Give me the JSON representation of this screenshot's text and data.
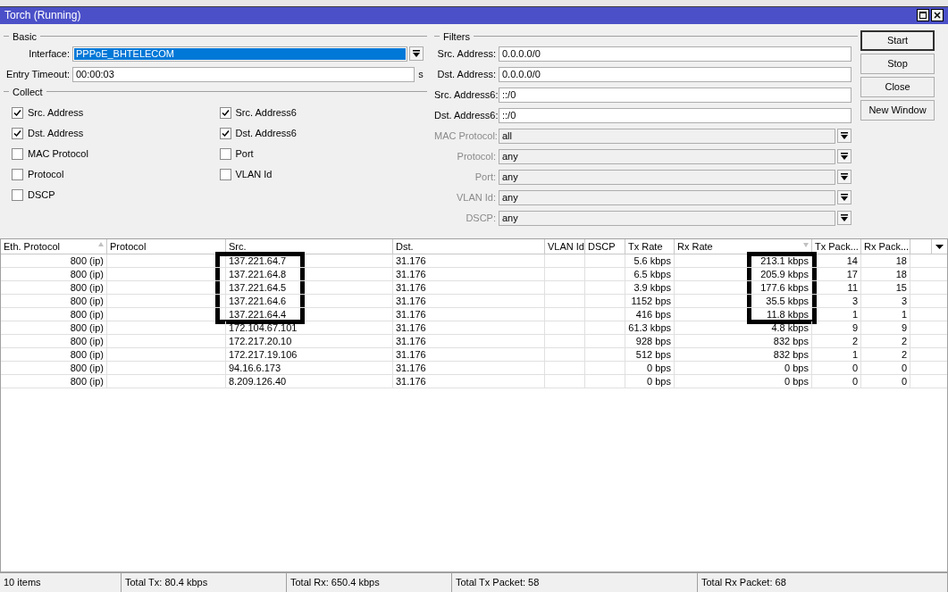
{
  "window": {
    "title": "Torch (Running)"
  },
  "basic": {
    "legend": "Basic",
    "interface": {
      "label": "Interface:",
      "value": "PPPoE_BHTELECOM",
      "selected": true
    },
    "entry_timeout": {
      "label": "Entry Timeout:",
      "value": "00:00:03",
      "unit": "s"
    }
  },
  "collect": {
    "legend": "Collect",
    "columns": [
      [
        {
          "label": "Src. Address",
          "checked": true
        },
        {
          "label": "Dst. Address",
          "checked": true
        },
        {
          "label": "MAC Protocol",
          "checked": false
        },
        {
          "label": "Protocol",
          "checked": false
        },
        {
          "label": "DSCP",
          "checked": false
        }
      ],
      [
        {
          "label": "Src. Address6",
          "checked": true
        },
        {
          "label": "Dst. Address6",
          "checked": true
        },
        {
          "label": "Port",
          "checked": false
        },
        {
          "label": "VLAN Id",
          "checked": false
        }
      ]
    ]
  },
  "filters": {
    "legend": "Filters",
    "fields": [
      {
        "label": "Src. Address:",
        "value": "0.0.0.0/0",
        "kind": "text",
        "disabled": false
      },
      {
        "label": "Dst. Address:",
        "value": "0.0.0.0/0",
        "kind": "text",
        "disabled": false
      },
      {
        "label": "Src. Address6:",
        "value": "::/0",
        "kind": "text",
        "disabled": false
      },
      {
        "label": "Dst. Address6:",
        "value": "::/0",
        "kind": "text",
        "disabled": false
      },
      {
        "label": "MAC Protocol:",
        "value": "all",
        "kind": "select",
        "disabled": true
      },
      {
        "label": "Protocol:",
        "value": "any",
        "kind": "select",
        "disabled": true
      },
      {
        "label": "Port:",
        "value": "any",
        "kind": "select",
        "disabled": true
      },
      {
        "label": "VLAN Id:",
        "value": "any",
        "kind": "select",
        "disabled": true
      },
      {
        "label": "DSCP:",
        "value": "any",
        "kind": "select",
        "disabled": true
      }
    ]
  },
  "buttons": [
    {
      "label": "Start",
      "default": true
    },
    {
      "label": "Stop",
      "default": false
    },
    {
      "label": "Close",
      "default": false
    },
    {
      "label": "New Window",
      "default": false
    }
  ],
  "table": {
    "columns": [
      {
        "label": "Eth. Protocol",
        "sorted": true,
        "descending": false
      },
      {
        "label": "Protocol",
        "sorted": false
      },
      {
        "label": "Src.",
        "sorted": false
      },
      {
        "label": "Dst.",
        "sorted": false
      },
      {
        "label": "VLAN Id",
        "sorted": false
      },
      {
        "label": "DSCP",
        "sorted": false
      },
      {
        "label": "Tx Rate",
        "sorted": false
      },
      {
        "label": "Rx Rate",
        "sorted": true,
        "descending": true
      },
      {
        "label": "Tx Pack...",
        "sorted": false
      },
      {
        "label": "Rx Pack...",
        "sorted": false
      }
    ],
    "rows": [
      {
        "highlighted": true,
        "cells": [
          "800 (ip)",
          "",
          "137.221.64.7",
          "31.176",
          "",
          "",
          "5.6 kbps",
          "213.1 kbps",
          "14",
          "18"
        ]
      },
      {
        "highlighted": true,
        "cells": [
          "800 (ip)",
          "",
          "137.221.64.8",
          "31.176",
          "",
          "",
          "6.5 kbps",
          "205.9 kbps",
          "17",
          "18"
        ]
      },
      {
        "highlighted": true,
        "cells": [
          "800 (ip)",
          "",
          "137.221.64.5",
          "31.176",
          "",
          "",
          "3.9 kbps",
          "177.6 kbps",
          "11",
          "15"
        ]
      },
      {
        "highlighted": true,
        "cells": [
          "800 (ip)",
          "",
          "137.221.64.6",
          "31.176",
          "",
          "",
          "1152 bps",
          "35.5 kbps",
          "3",
          "3"
        ]
      },
      {
        "highlighted": true,
        "cells": [
          "800 (ip)",
          "",
          "137.221.64.4",
          "31.176",
          "",
          "",
          "416 bps",
          "11.8 kbps",
          "1",
          "1"
        ]
      },
      {
        "highlighted": false,
        "cells": [
          "800 (ip)",
          "",
          "172.104.67.101",
          "31.176",
          "",
          "",
          "61.3 kbps",
          "4.8 kbps",
          "9",
          "9"
        ]
      },
      {
        "highlighted": false,
        "cells": [
          "800 (ip)",
          "",
          "172.217.20.10",
          "31.176",
          "",
          "",
          "928 bps",
          "832 bps",
          "2",
          "2"
        ]
      },
      {
        "highlighted": false,
        "cells": [
          "800 (ip)",
          "",
          "172.217.19.106",
          "31.176",
          "",
          "",
          "512 bps",
          "832 bps",
          "1",
          "2"
        ]
      },
      {
        "highlighted": false,
        "cells": [
          "800 (ip)",
          "",
          "94.16.6.173",
          "31.176",
          "",
          "",
          "0 bps",
          "0 bps",
          "0",
          "0"
        ]
      },
      {
        "highlighted": false,
        "cells": [
          "800 (ip)",
          "",
          "8.209.126.40",
          "31.176",
          "",
          "",
          "0 bps",
          "0 bps",
          "0",
          "0"
        ]
      }
    ]
  },
  "status_bar": [
    "10 items",
    "Total Tx: 80.4 kbps",
    "Total Rx: 650.4 kbps",
    "Total Tx Packet: 58",
    "Total Rx Packet: 68"
  ]
}
